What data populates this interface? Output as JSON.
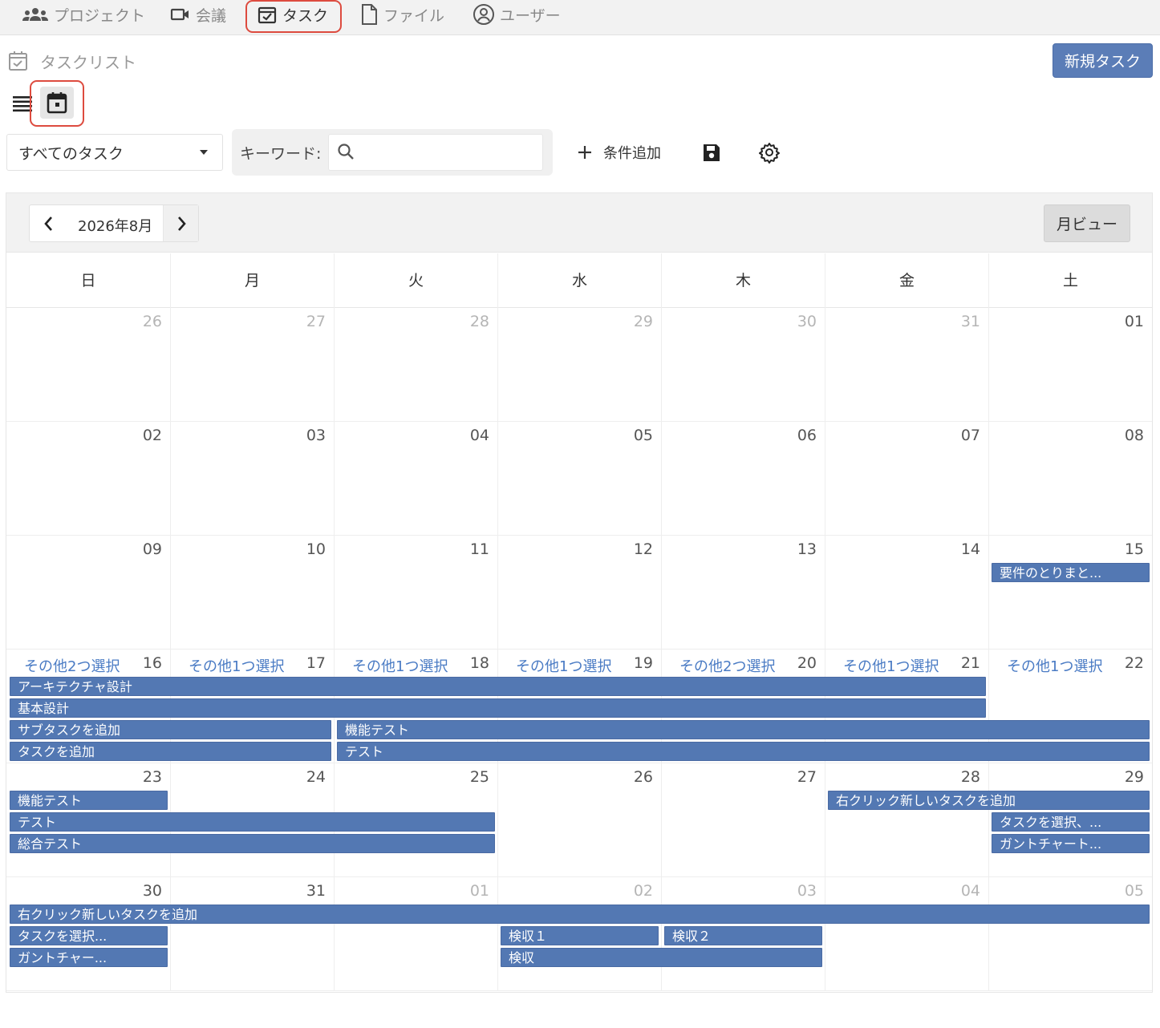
{
  "nav": {
    "project": "プロジェクト",
    "meeting": "会議",
    "task": "タスク",
    "file": "ファイル",
    "user": "ユーザー"
  },
  "header": {
    "title": "タスクリスト",
    "new_task": "新規タスク"
  },
  "filter": {
    "select_value": "すべてのタスク",
    "keyword_label": "キーワード:",
    "keyword_placeholder": "",
    "add_condition": "条件追加"
  },
  "calendar": {
    "month_label": "2026年8月",
    "month_view": "月ビュー",
    "weekdays": [
      "日",
      "月",
      "火",
      "水",
      "木",
      "金",
      "土"
    ],
    "weeks": [
      {
        "days": [
          {
            "n": "26",
            "other": true
          },
          {
            "n": "27",
            "other": true
          },
          {
            "n": "28",
            "other": true
          },
          {
            "n": "29",
            "other": true
          },
          {
            "n": "30",
            "other": true
          },
          {
            "n": "31",
            "other": true
          },
          {
            "n": "01",
            "other": false
          }
        ]
      },
      {
        "days": [
          {
            "n": "02",
            "other": false
          },
          {
            "n": "03",
            "other": false
          },
          {
            "n": "04",
            "other": false
          },
          {
            "n": "05",
            "other": false
          },
          {
            "n": "06",
            "other": false
          },
          {
            "n": "07",
            "other": false
          },
          {
            "n": "08",
            "other": false
          }
        ]
      },
      {
        "days": [
          {
            "n": "09",
            "other": false
          },
          {
            "n": "10",
            "other": false
          },
          {
            "n": "11",
            "other": false
          },
          {
            "n": "12",
            "other": false
          },
          {
            "n": "13",
            "other": false
          },
          {
            "n": "14",
            "other": false
          },
          {
            "n": "15",
            "other": false
          }
        ]
      },
      {
        "days": [
          {
            "n": "16",
            "other": false,
            "more": "その他2つ選択"
          },
          {
            "n": "17",
            "other": false,
            "more": "その他1つ選択"
          },
          {
            "n": "18",
            "other": false,
            "more": "その他1つ選択"
          },
          {
            "n": "19",
            "other": false,
            "more": "その他1つ選択"
          },
          {
            "n": "20",
            "other": false,
            "more": "その他2つ選択"
          },
          {
            "n": "21",
            "other": false,
            "more": "その他1つ選択"
          },
          {
            "n": "22",
            "other": false,
            "more": "その他1つ選択"
          }
        ]
      },
      {
        "days": [
          {
            "n": "23",
            "other": false
          },
          {
            "n": "24",
            "other": false
          },
          {
            "n": "25",
            "other": false
          },
          {
            "n": "26",
            "other": false
          },
          {
            "n": "27",
            "other": false
          },
          {
            "n": "28",
            "other": false
          },
          {
            "n": "29",
            "other": false
          }
        ]
      },
      {
        "days": [
          {
            "n": "30",
            "other": false
          },
          {
            "n": "31",
            "other": false
          },
          {
            "n": "01",
            "other": true
          },
          {
            "n": "02",
            "other": true
          },
          {
            "n": "03",
            "other": true
          },
          {
            "n": "04",
            "other": true
          },
          {
            "n": "05",
            "other": true
          }
        ]
      }
    ],
    "events": [
      {
        "title": "要件のとりまと...",
        "week": 2,
        "start": 6,
        "span": 1,
        "lane": 0
      },
      {
        "title": "アーキテクチャ設計",
        "week": 3,
        "start": 0,
        "span": 6,
        "lane": 0
      },
      {
        "title": "基本設計",
        "week": 3,
        "start": 0,
        "span": 6,
        "lane": 1
      },
      {
        "title": "サブタスクを追加",
        "week": 3,
        "start": 0,
        "span": 2,
        "lane": 2
      },
      {
        "title": "機能テスト",
        "week": 3,
        "start": 2,
        "span": 5,
        "lane": 2
      },
      {
        "title": "タスクを追加",
        "week": 3,
        "start": 0,
        "span": 2,
        "lane": 3
      },
      {
        "title": "テスト",
        "week": 3,
        "start": 2,
        "span": 5,
        "lane": 3
      },
      {
        "title": "機能テスト",
        "week": 4,
        "start": 0,
        "span": 1,
        "lane": 0
      },
      {
        "title": "右クリック新しいタスクを追加",
        "week": 4,
        "start": 5,
        "span": 2,
        "lane": 0
      },
      {
        "title": "テスト",
        "week": 4,
        "start": 0,
        "span": 3,
        "lane": 1
      },
      {
        "title": "タスクを選択、...",
        "week": 4,
        "start": 6,
        "span": 1,
        "lane": 1
      },
      {
        "title": "総合テスト",
        "week": 4,
        "start": 0,
        "span": 3,
        "lane": 2
      },
      {
        "title": "ガントチャート...",
        "week": 4,
        "start": 6,
        "span": 1,
        "lane": 2
      },
      {
        "title": "右クリック新しいタスクを追加",
        "week": 5,
        "start": 0,
        "span": 7,
        "lane": 0
      },
      {
        "title": "タスクを選択...",
        "week": 5,
        "start": 0,
        "span": 1,
        "lane": 1
      },
      {
        "title": "検収１",
        "week": 5,
        "start": 3,
        "span": 1,
        "lane": 1
      },
      {
        "title": "検収２",
        "week": 5,
        "start": 4,
        "span": 1,
        "lane": 1
      },
      {
        "title": "ガントチャー...",
        "week": 5,
        "start": 0,
        "span": 1,
        "lane": 2
      },
      {
        "title": "検収",
        "week": 5,
        "start": 3,
        "span": 2,
        "lane": 2
      }
    ]
  },
  "colors": {
    "accent": "#5b7db7",
    "event": "#5378b3",
    "highlight": "#dd4b3f",
    "link": "#4a7bc4"
  }
}
